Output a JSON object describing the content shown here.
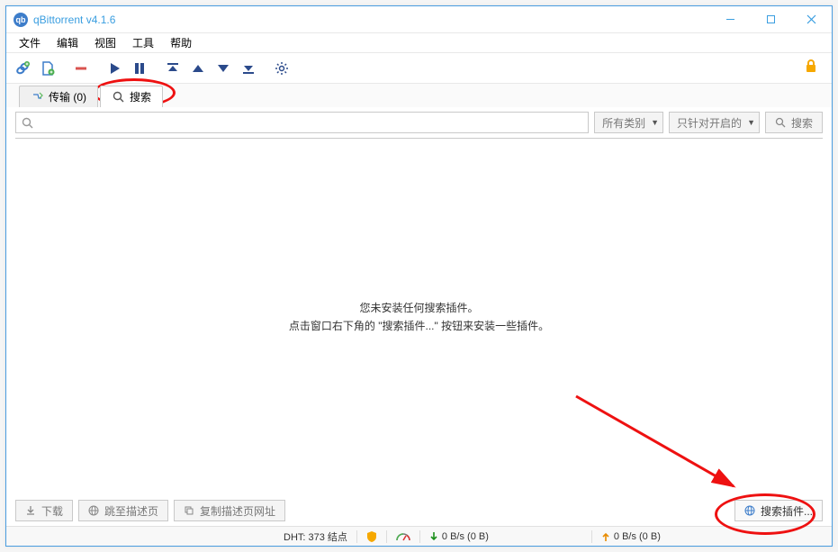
{
  "titlebar": {
    "title": "qBittorrent v4.1.6"
  },
  "menubar": [
    "文件",
    "编辑",
    "视图",
    "工具",
    "帮助"
  ],
  "tabs": {
    "transfers": {
      "label": "传输 (0)"
    },
    "search": {
      "label": "搜索"
    }
  },
  "searchrow": {
    "placeholder": "",
    "category": "所有类别",
    "scope": "只针对开启的",
    "searchBtn": "搜索"
  },
  "maincontent": {
    "line1": "您未安装任何搜索插件。",
    "line2": "点击窗口右下角的 \"搜索插件...\" 按钮来安装一些插件。"
  },
  "bottomrow": {
    "download": "下载",
    "gotoPage": "跳至描述页",
    "copyUrl": "复制描述页网址",
    "plugins": "搜索插件..."
  },
  "statusbar": {
    "dht": "DHT: 373 结点",
    "down": "0 B/s (0 B)",
    "up": "0 B/s (0 B)"
  }
}
